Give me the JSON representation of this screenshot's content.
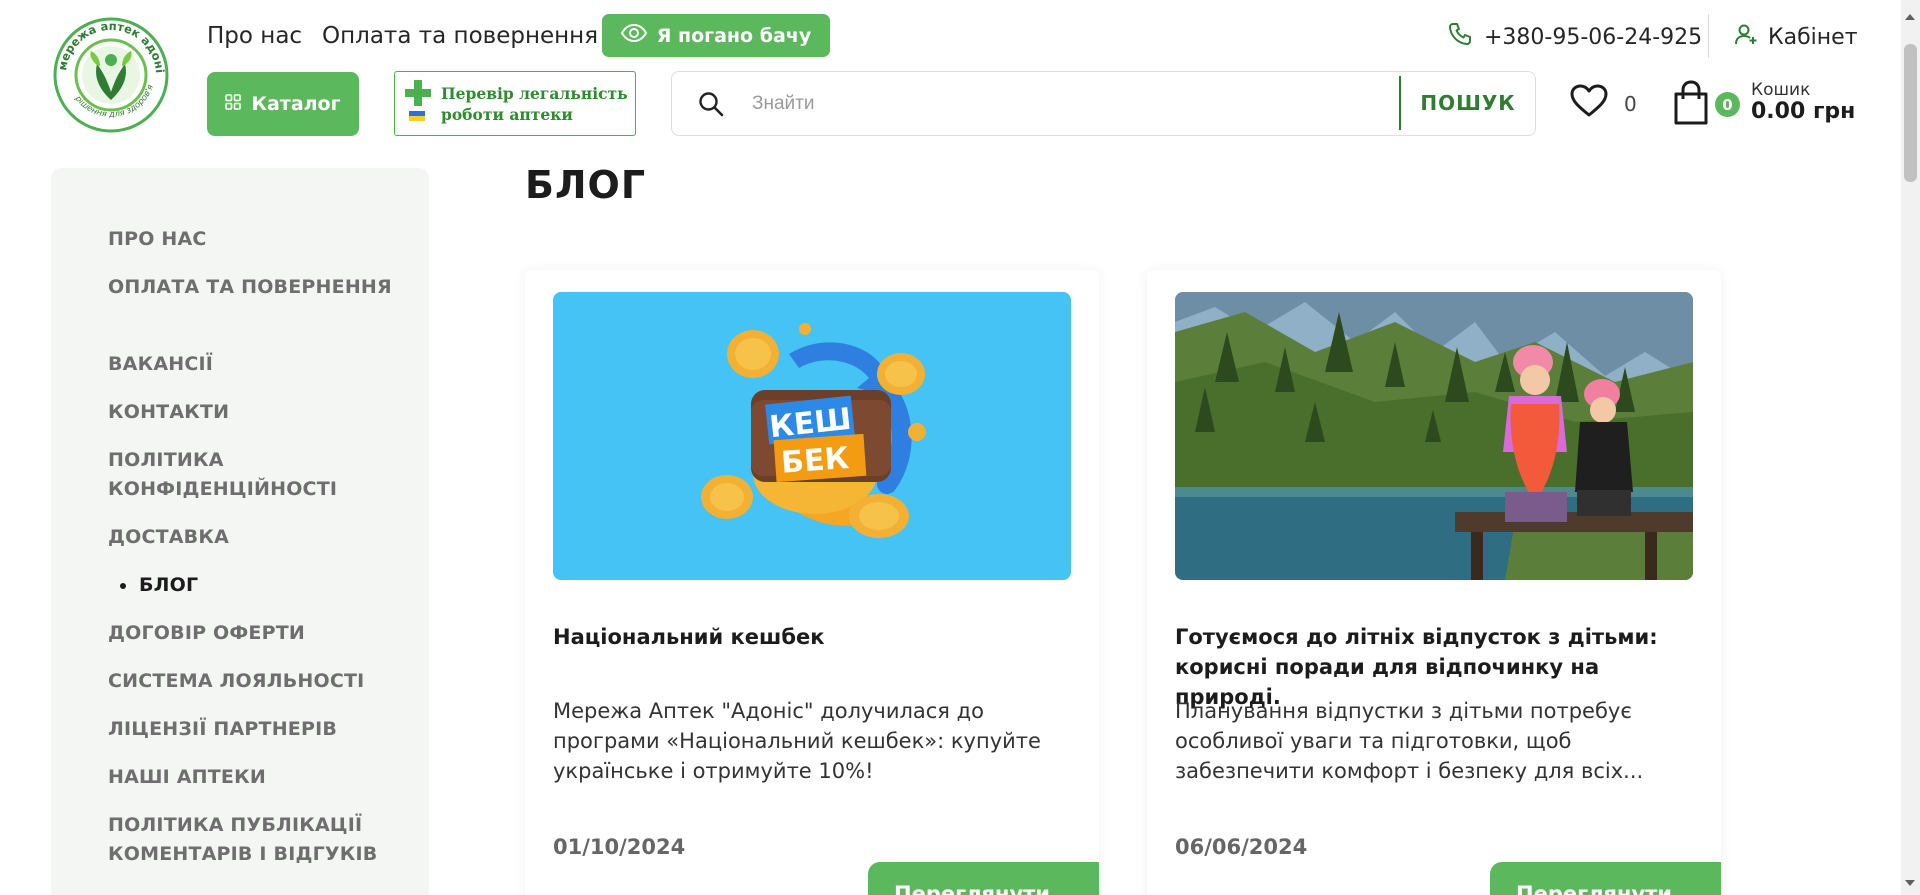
{
  "brand": {
    "logo_text_top": "мережа аптек адоніс",
    "logo_text_bottom": "рішення для здоров'я",
    "accent_color": "#5cb85c",
    "dark_green": "#2e7d32"
  },
  "header": {
    "links": [
      "Про нас",
      "Оплата та повернення"
    ],
    "low_vision_label": "Я погано бачу",
    "phone": "+380-95-06-24-925",
    "cabinet_label": "Кабінет",
    "catalog_label": "Каталог",
    "legal_check": [
      "Перевір легальність",
      "роботи аптеки"
    ],
    "search": {
      "placeholder": "Знайти",
      "value": "",
      "button_label": "ПОШУК"
    },
    "wishlist_count": "0",
    "cart": {
      "count": "0",
      "label": "Кошик",
      "total": "0.00 грн"
    }
  },
  "sidebar": {
    "items": [
      {
        "label": "ПРО НАС"
      },
      {
        "label": "ОПЛАТА ТА ПОВЕРНЕННЯ"
      },
      {
        "label": "ВАКАНСІЇ"
      },
      {
        "label": "КОНТАКТИ"
      },
      {
        "label": "ПОЛІТИКА КОНФІДЕНЦІЙНОСТІ"
      },
      {
        "label": "ДОСТАВКА"
      },
      {
        "label": "БЛОГ",
        "active": true
      },
      {
        "label": "ДОГОВІР ОФЕРТИ"
      },
      {
        "label": "СИСТЕМА ЛОЯЛЬНОСТІ"
      },
      {
        "label": "ЛІЦЕНЗІЇ ПАРТНЕРІВ"
      },
      {
        "label": "НАШІ АПТЕКИ"
      },
      {
        "label": "ПОЛІТИКА ПУБЛІКАЦІЇ КОМЕНТАРІВ І ВІДГУКІВ"
      }
    ]
  },
  "main": {
    "title": "БЛОГ",
    "posts": [
      {
        "title": "Національний кешбек",
        "excerpt": "Мережа Аптек \"Адоніс\" долучилася до програми «Національний кешбек»: купуйте українське і отримуйте 10%!",
        "date": "01/10/2024",
        "button_label": "Переглянути",
        "image_text": [
          "КЕШ",
          "БЕК"
        ]
      },
      {
        "title": "Готуємося до літніх відпусток з дітьми: корисні поради для відпочинку на природі.",
        "excerpt": "Планування відпустки з дітьми потребує особливої уваги та підготовки, щоб забезпечити комфорт і безпеку для всіх...",
        "date": "06/06/2024",
        "button_label": "Переглянути"
      }
    ]
  }
}
